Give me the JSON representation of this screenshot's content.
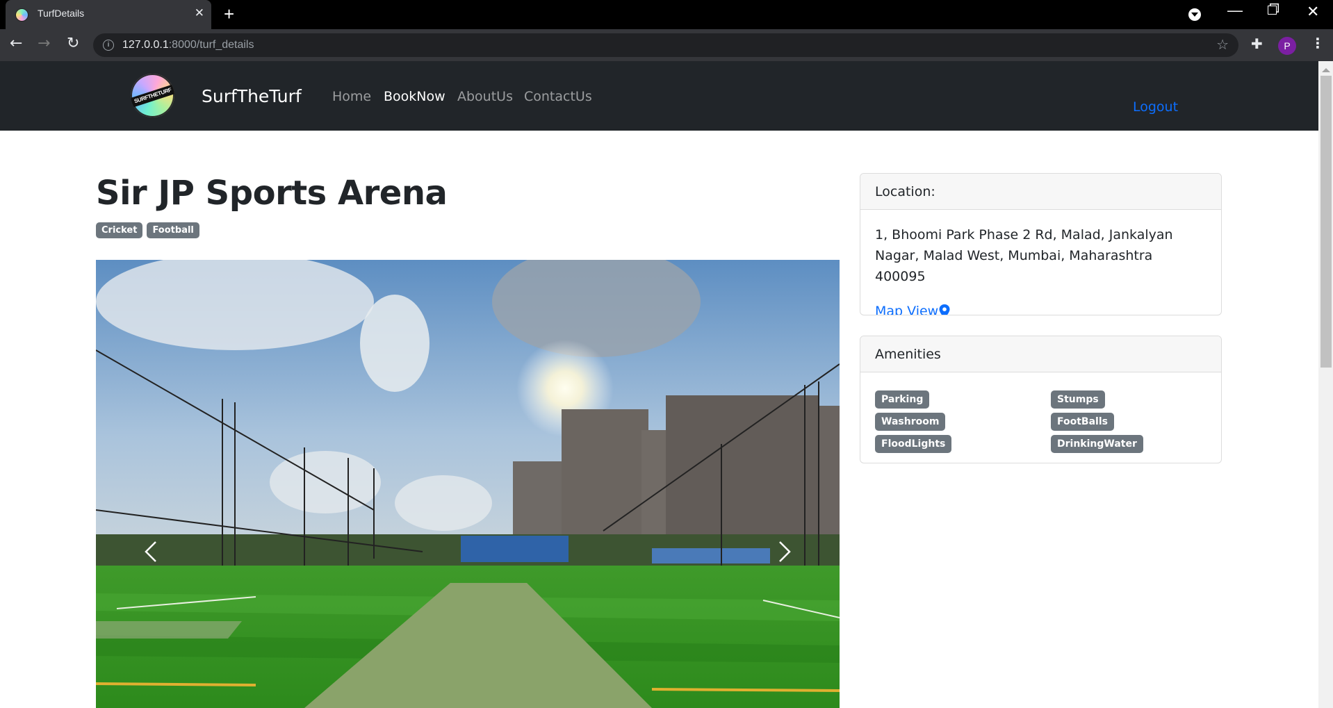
{
  "browser": {
    "tab_title": "TurfDetails",
    "url_host": "127.0.0.1",
    "url_rest": ":8000/turf_details",
    "profile_initial": "P",
    "icons": {
      "back": "arrow-left",
      "forward": "arrow-right",
      "reload": "reload",
      "info": "info-circle",
      "star": "star-outline",
      "extensions": "puzzle",
      "menu": "kebab",
      "new_tab": "plus",
      "close_tab": "x"
    }
  },
  "navbar": {
    "brand": "SurfTheTurf",
    "logo_text": "SURFTHETURF",
    "links": [
      {
        "label": "Home",
        "active": false
      },
      {
        "label": "BookNow",
        "active": true
      },
      {
        "label": "AboutUs",
        "active": false
      },
      {
        "label": "ContactUs",
        "active": false
      }
    ],
    "logout": "Logout"
  },
  "turf": {
    "name": "Sir JP Sports Arena",
    "sports": [
      "Cricket",
      "Football"
    ]
  },
  "location": {
    "header": "Location:",
    "address": "1, Bhoomi Park Phase 2 Rd, Malad, Jankalyan Nagar, Malad West, Mumbai, Maharashtra 400095",
    "map_link": "Map View"
  },
  "amenities": {
    "header": "Amenities",
    "items": [
      "Parking",
      "Stumps",
      "Washroom",
      "FootBalls",
      "FloodLights",
      "DrinkingWater"
    ]
  },
  "colors": {
    "navbar_bg": "#212529",
    "link_blue": "#0d6efd",
    "badge_gray": "#6c757d"
  }
}
